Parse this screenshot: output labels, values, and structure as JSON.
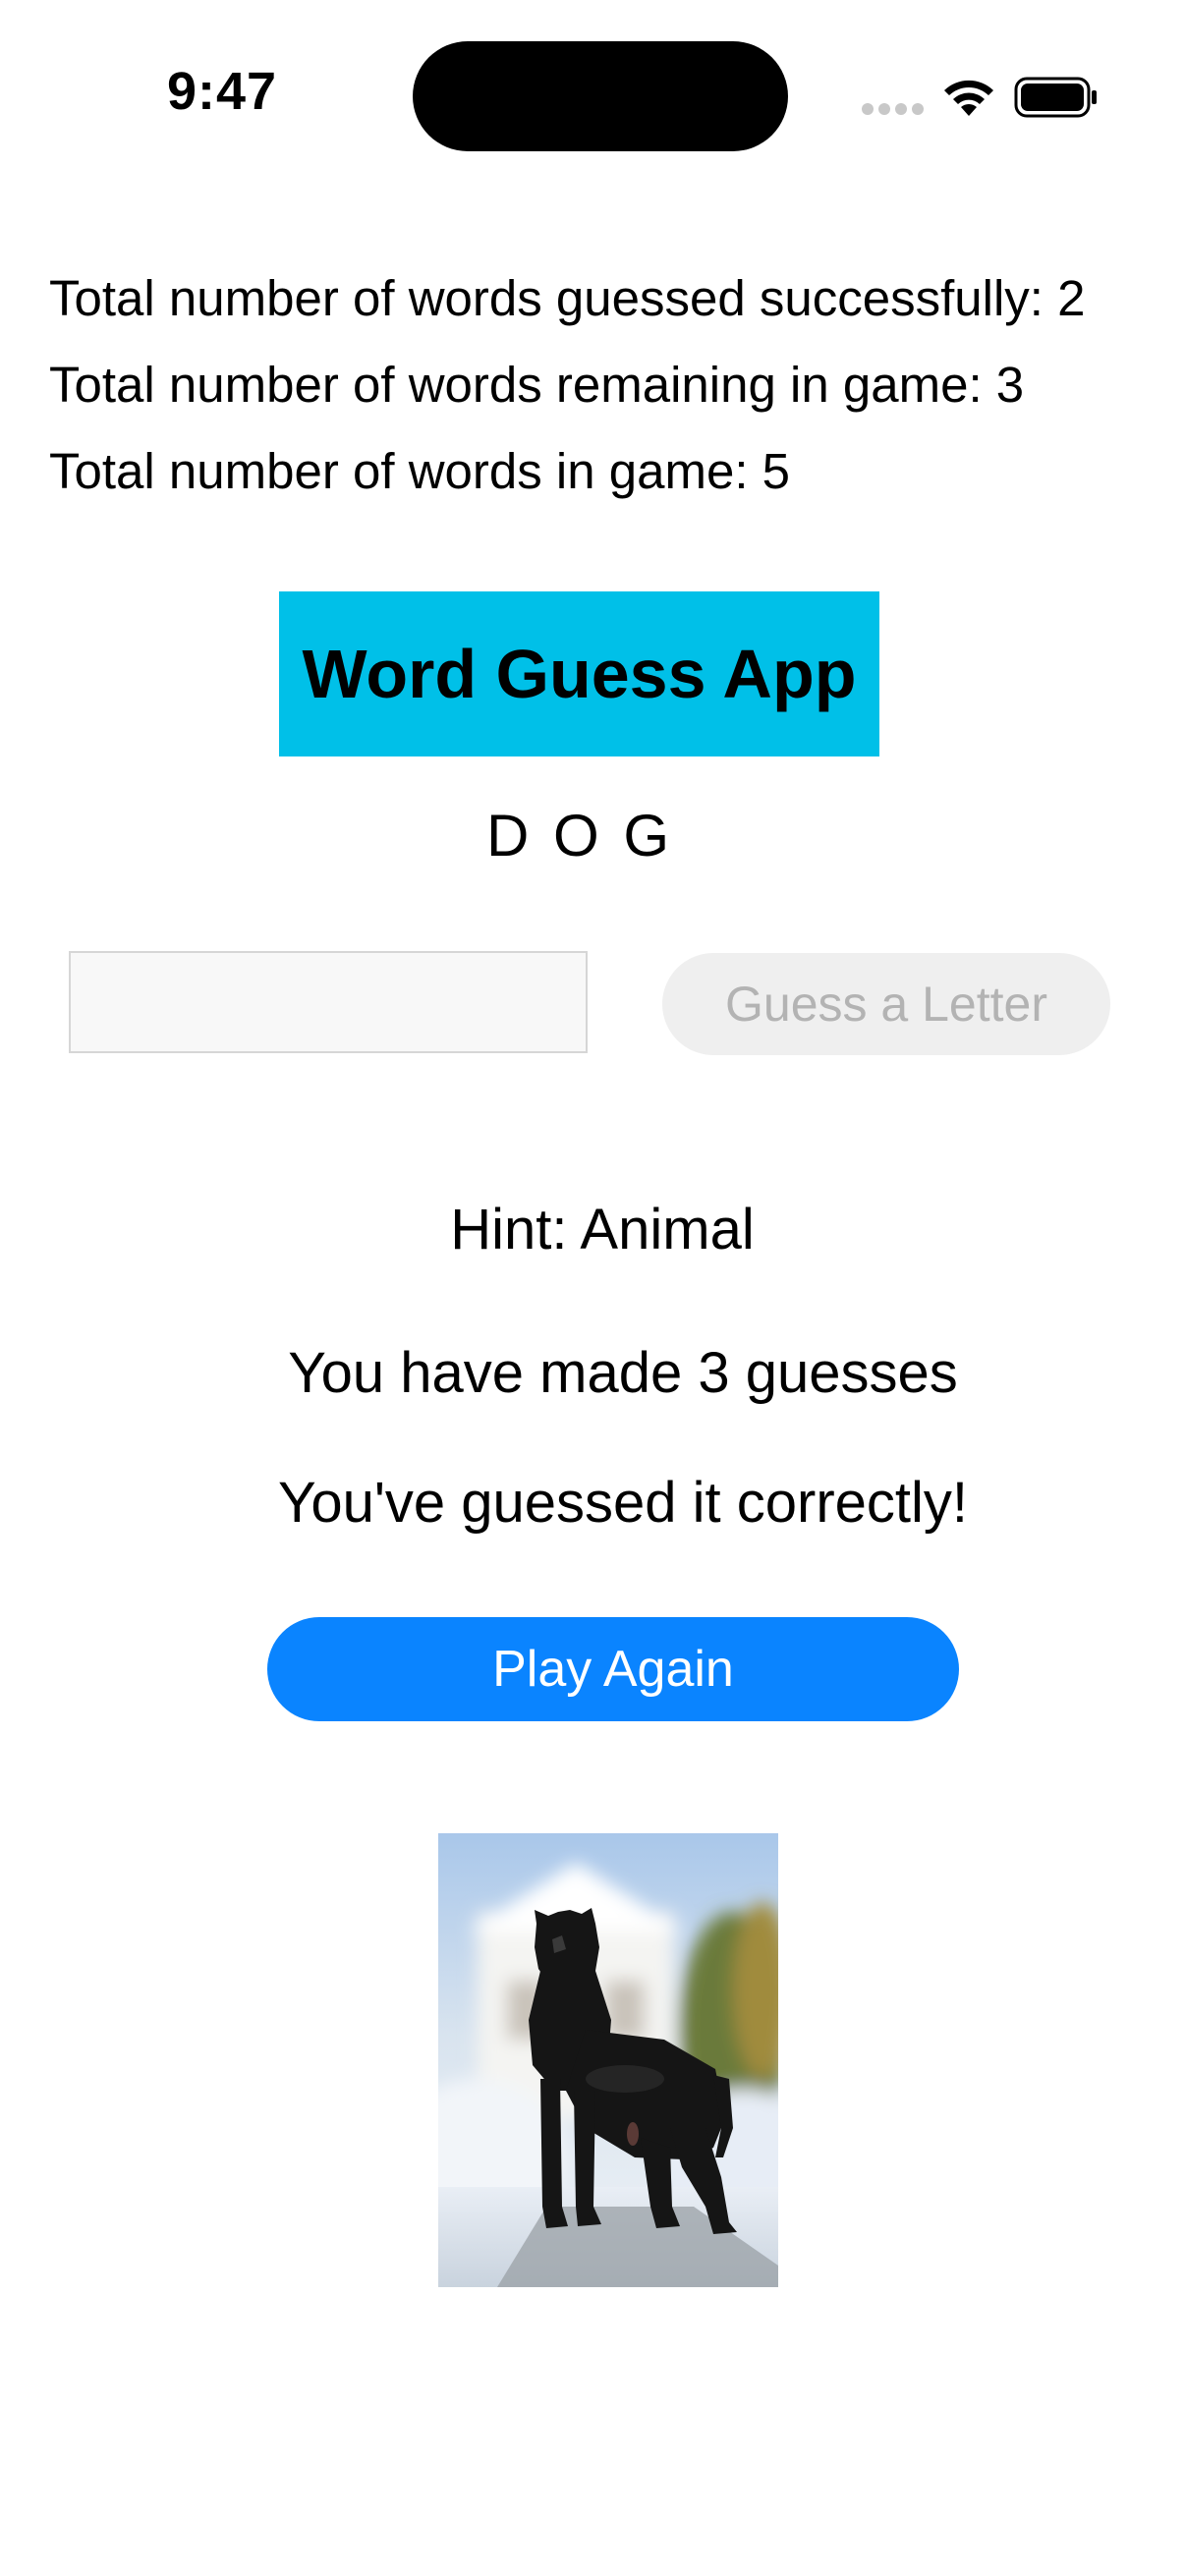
{
  "status_bar": {
    "time": "9:47"
  },
  "stats": {
    "guessed_successfully": "Total number of words guessed successfully: 2",
    "remaining": "Total number of words remaining in game: 3",
    "total": "Total number of words in game: 5"
  },
  "app": {
    "title": "Word Guess App",
    "title_bg_color": "#00c0e8"
  },
  "game": {
    "word_display": "D O G",
    "input_value": "",
    "guess_button_label": "Guess a Letter",
    "hint": "Hint: Animal",
    "guess_count_text": "You have made 3 guesses",
    "result_text": "You've guessed it correctly!",
    "play_again_label": "Play Again",
    "play_again_color": "#0a84ff"
  }
}
